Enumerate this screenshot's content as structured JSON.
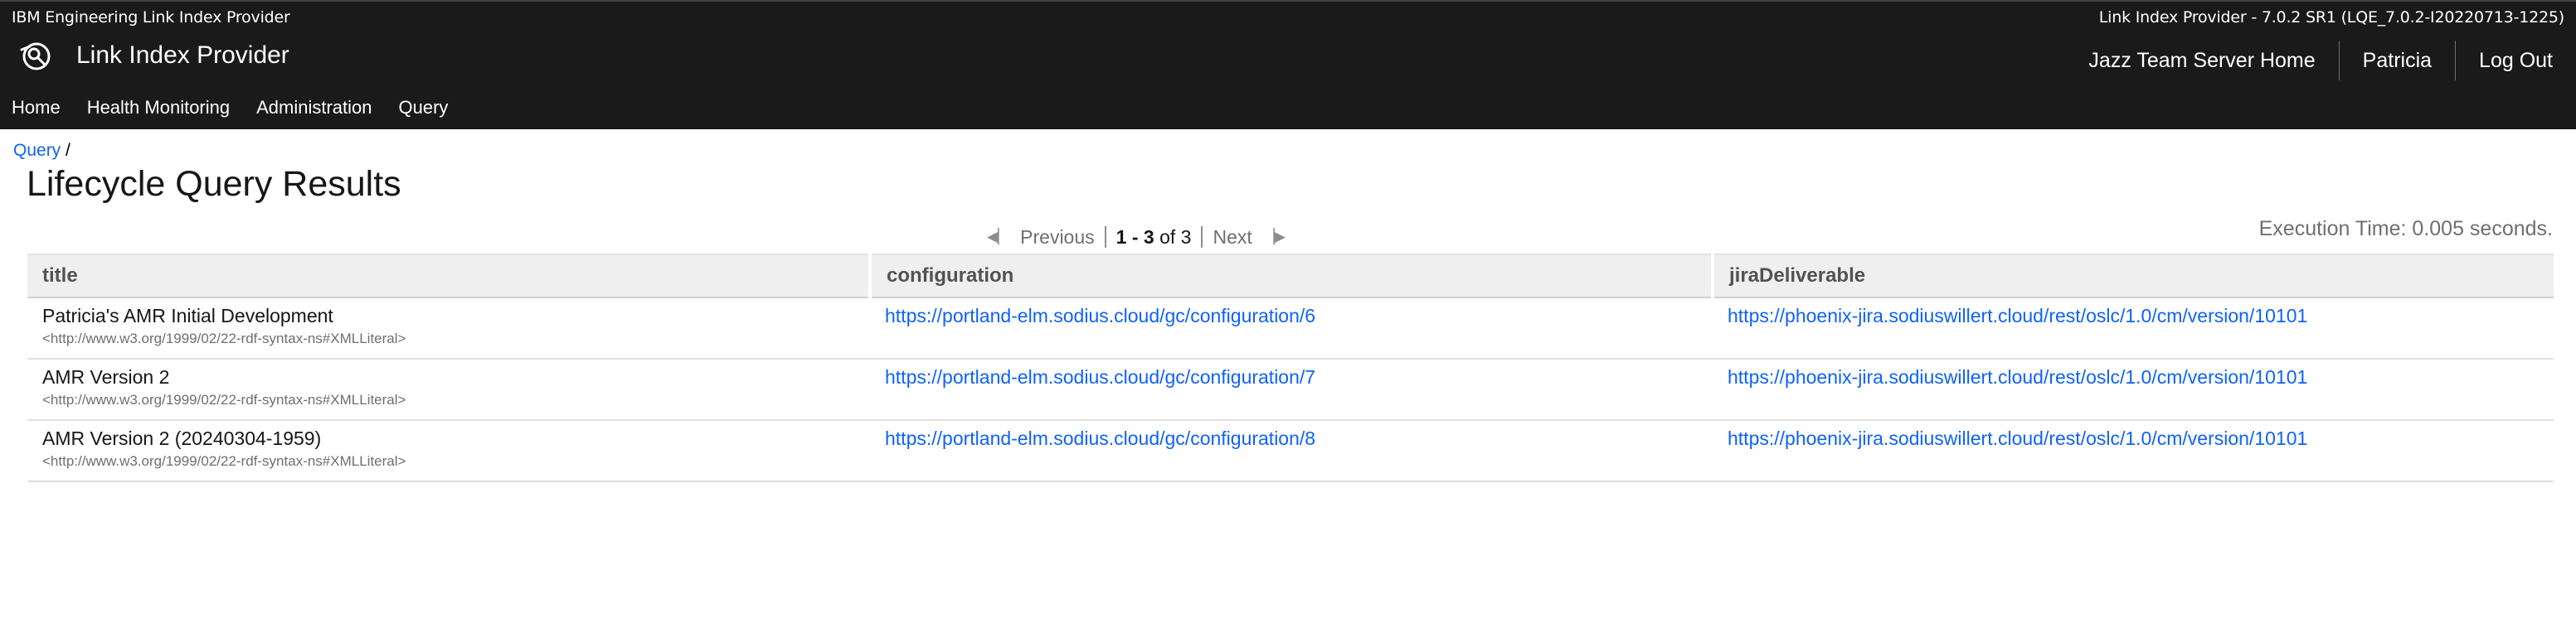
{
  "header": {
    "product_name": "IBM Engineering Link Index Provider",
    "version_info": "Link Index Provider - 7.0.2 SR1 (LQE_7.0.2-I20220713-1225)",
    "app_title": "Link Index Provider",
    "logo_icon": "link-index-logo-icon",
    "right_links": [
      "Jazz Team Server Home",
      "Patricia",
      "Log Out"
    ]
  },
  "nav": {
    "items": [
      "Home",
      "Health Monitoring",
      "Administration",
      "Query"
    ]
  },
  "breadcrumb": {
    "link": "Query",
    "separator": " /"
  },
  "page": {
    "title": "Lifecycle Query Results"
  },
  "pager": {
    "first_icon": "first-page-icon",
    "previous": "Previous",
    "range_start": "1",
    "range_dash": " - ",
    "range_end": "3",
    "range_of": " of ",
    "total": "3",
    "next": "Next",
    "last_icon": "last-page-icon"
  },
  "execution_time": "Execution Time: 0.005 seconds.",
  "table": {
    "columns": [
      "title",
      "configuration",
      "jiraDeliverable"
    ],
    "rows": [
      {
        "title": "Patricia's AMR Initial Development",
        "title_type": "<http://www.w3.org/1999/02/22-rdf-syntax-ns#XMLLiteral>",
        "configuration": "https://portland-elm.sodius.cloud/gc/configuration/6",
        "jiraDeliverable": "https://phoenix-jira.sodiuswillert.cloud/rest/oslc/1.0/cm/version/10101"
      },
      {
        "title": "AMR Version 2",
        "title_type": "<http://www.w3.org/1999/02/22-rdf-syntax-ns#XMLLiteral>",
        "configuration": "https://portland-elm.sodius.cloud/gc/configuration/7",
        "jiraDeliverable": "https://phoenix-jira.sodiuswillert.cloud/rest/oslc/1.0/cm/version/10101"
      },
      {
        "title": "AMR Version 2 (20240304-1959)",
        "title_type": "<http://www.w3.org/1999/02/22-rdf-syntax-ns#XMLLiteral>",
        "configuration": "https://portland-elm.sodius.cloud/gc/configuration/8",
        "jiraDeliverable": "https://phoenix-jira.sodiuswillert.cloud/rest/oslc/1.0/cm/version/10101"
      }
    ]
  },
  "colors": {
    "banner": "#1a1a1a",
    "link": "#0f62fe",
    "header_row": "#efefef"
  }
}
